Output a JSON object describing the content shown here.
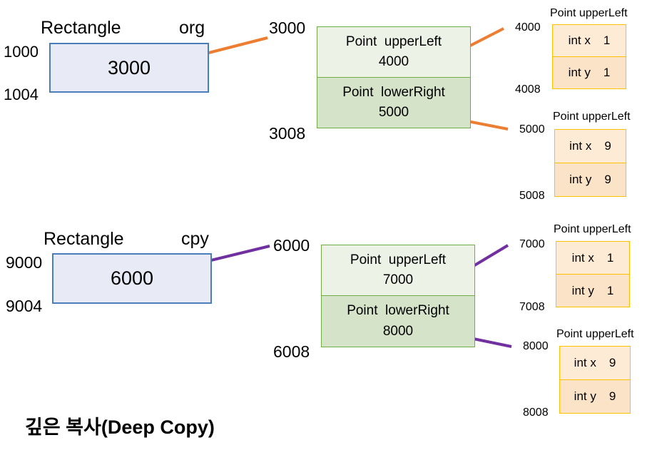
{
  "org": {
    "label_left": "Rectangle",
    "label_right": "org",
    "addr_top": "1000",
    "addr_bottom": "1004",
    "value": "3000",
    "block_addr_top": "3000",
    "block_addr_bottom": "3008",
    "upper": {
      "label": "Point  upperLeft",
      "value": "4000"
    },
    "lower": {
      "label": "Point  lowerRight",
      "value": "5000"
    },
    "p1": {
      "title": "Point upperLeft",
      "addr_top": "4000",
      "addr_bottom": "4008",
      "x_label": "int x",
      "x_val": "1",
      "y_label": "int y",
      "y_val": "1"
    },
    "p2": {
      "title": "Point upperLeft",
      "addr_top": "5000",
      "addr_bottom": "5008",
      "x_label": "int x",
      "x_val": "9",
      "y_label": "int y",
      "y_val": "9"
    }
  },
  "cpy": {
    "label_left": "Rectangle",
    "label_right": "cpy",
    "addr_top": "9000",
    "addr_bottom": "9004",
    "value": "6000",
    "block_addr_top": "6000",
    "block_addr_bottom": "6008",
    "upper": {
      "label": "Point  upperLeft",
      "value": "7000"
    },
    "lower": {
      "label": "Point  lowerRight",
      "value": "8000"
    },
    "p1": {
      "title": "Point upperLeft",
      "addr_top": "7000",
      "addr_bottom": "7008",
      "x_label": "int x",
      "x_val": "1",
      "y_label": "int y",
      "y_val": "1"
    },
    "p2": {
      "title": "Point upperLeft",
      "addr_top": "8000",
      "addr_bottom": "8008",
      "x_label": "int x",
      "x_val": "9",
      "y_label": "int y",
      "y_val": "9"
    }
  },
  "caption": "깊은 복사(Deep Copy)",
  "colors": {
    "org_arrow": "#ed7d31",
    "cpy_arrow": "#7030a0"
  }
}
